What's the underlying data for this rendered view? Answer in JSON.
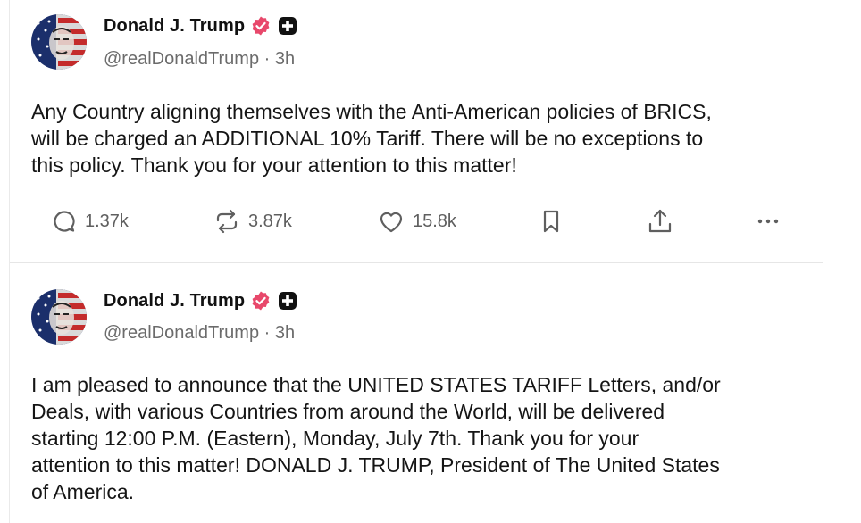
{
  "posts": [
    {
      "author": {
        "name": "Donald J. Trump",
        "handle": "@realDonaldTrump",
        "time": "· 3h",
        "badges": [
          "verified-badge-icon",
          "plus-badge-icon"
        ]
      },
      "text": "Any Country aligning themselves with the Anti-American policies of BRICS,\nwill be charged an ADDITIONAL 10% Tariff. There will be no exceptions to\nthis policy. Thank you for your attention to this matter!",
      "actions": {
        "replies": "1.37k",
        "restates": "3.87k",
        "likes": "15.8k"
      }
    },
    {
      "author": {
        "name": "Donald J. Trump",
        "handle": "@realDonaldTrump",
        "time": "· 3h",
        "badges": [
          "verified-badge-icon",
          "plus-badge-icon"
        ]
      },
      "text": "I am pleased to announce that the UNITED STATES TARIFF Letters, and/or\nDeals, with various Countries from around the World, will be delivered\nstarting 12:00 P.M. (Eastern), Monday, July 7th. Thank you for your\nattention to this matter! DONALD J. TRUMP, President of The United States\nof America."
    }
  ],
  "colors": {
    "verified": "#e8486b",
    "text": "#151515",
    "muted": "#6b6b6b",
    "icon": "#5f5f5f"
  }
}
